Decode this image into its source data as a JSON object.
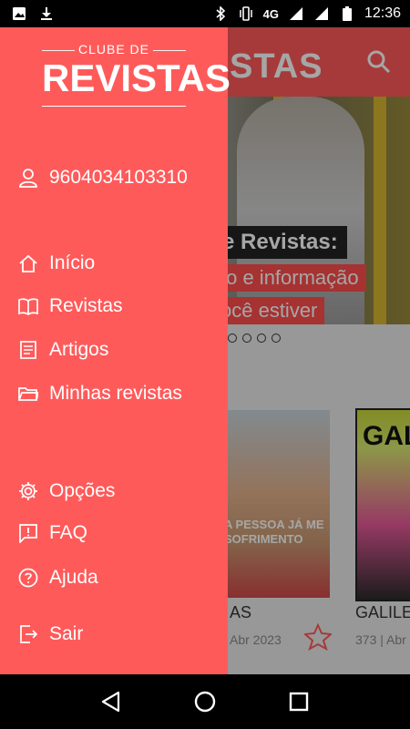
{
  "status_bar": {
    "time": "12:36",
    "network": "4G",
    "icons": [
      "image-icon",
      "download-icon",
      "bluetooth-icon",
      "vibrate-icon",
      "signal-icon",
      "signal-icon",
      "battery-icon"
    ]
  },
  "drawer": {
    "logo_top": "CLUBE DE",
    "logo_main": "REVISTAS",
    "user_id": "9604034103310",
    "items": [
      {
        "label": "Início",
        "icon": "home-icon"
      },
      {
        "label": "Revistas",
        "icon": "book-icon"
      },
      {
        "label": "Artigos",
        "icon": "article-icon"
      },
      {
        "label": "Minhas revistas",
        "icon": "folder-icon"
      }
    ],
    "secondary_items": [
      {
        "label": "Opções",
        "icon": "gear-icon"
      },
      {
        "label": "FAQ",
        "icon": "faq-icon"
      },
      {
        "label": "Ajuda",
        "icon": "help-icon"
      }
    ],
    "logout_label": "Sair"
  },
  "background": {
    "header_brand_fragment": "STAS",
    "banner_headline": "e Revistas:",
    "banner_line1": "to e informação",
    "banner_line2": "ocê estiver",
    "magazines": [
      {
        "title": "AS",
        "date": "Abr 2023",
        "cover_text": "A PESSOA JÁ ME SOFRIMENTO"
      },
      {
        "title": "GALILE",
        "date": "373 | Abr",
        "cover_text": "GAL"
      }
    ]
  },
  "colors": {
    "accent": "#ff5a5a"
  },
  "nav_bar": {
    "buttons": [
      "back-icon",
      "home-circle-icon",
      "recents-icon"
    ]
  }
}
